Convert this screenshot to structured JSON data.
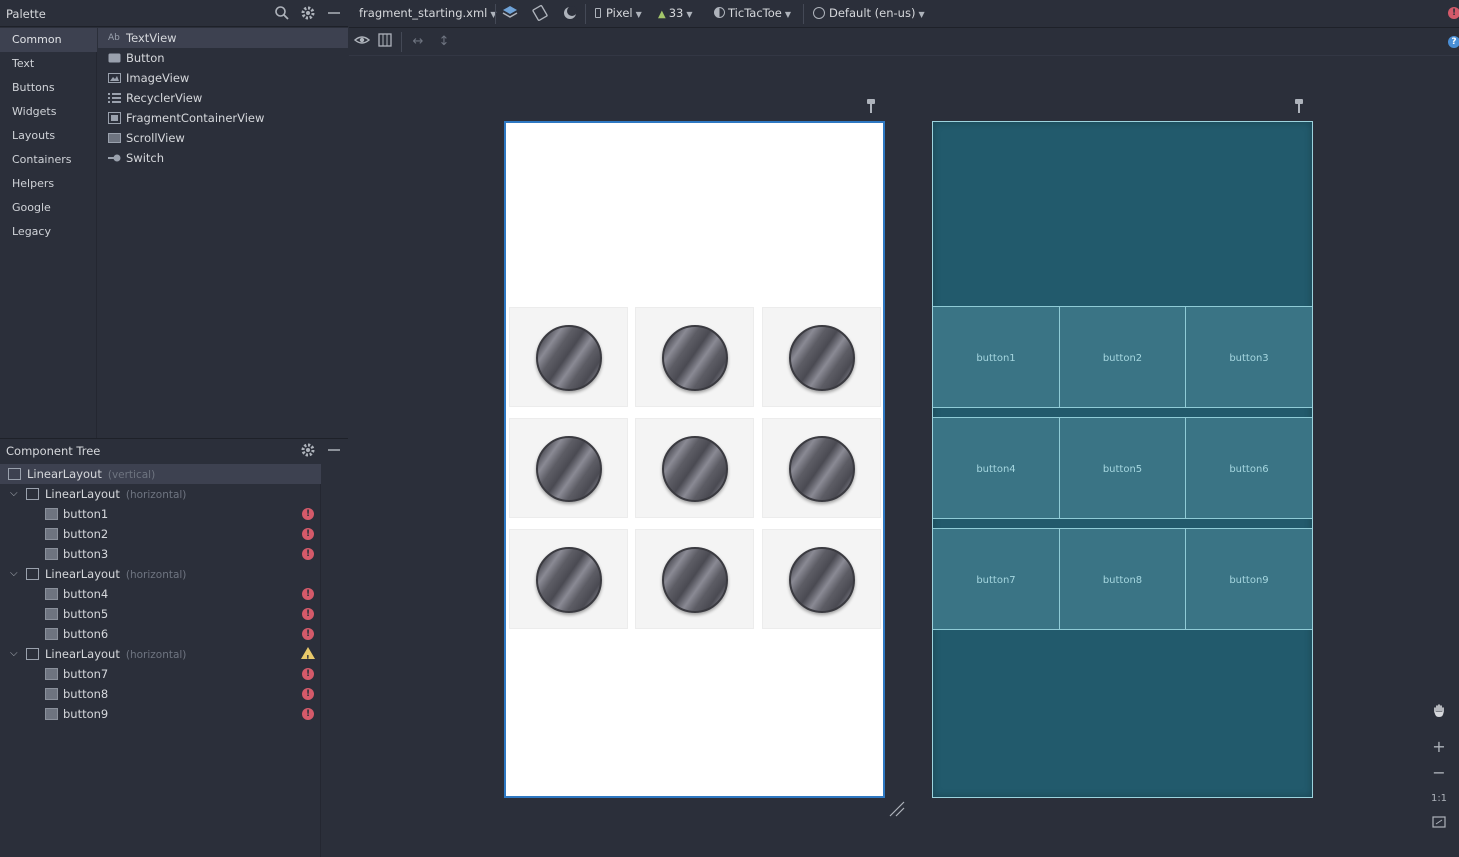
{
  "palette": {
    "title": "Palette",
    "categories": [
      "Common",
      "Text",
      "Buttons",
      "Widgets",
      "Layouts",
      "Containers",
      "Helpers",
      "Google",
      "Legacy"
    ],
    "items": [
      {
        "icon": "Ab",
        "label": "TextView"
      },
      {
        "icon": "",
        "label": "Button"
      },
      {
        "icon": "",
        "label": "ImageView"
      },
      {
        "icon": "",
        "label": "RecyclerView"
      },
      {
        "icon": "",
        "label": "FragmentContainerView"
      },
      {
        "icon": "",
        "label": "ScrollView"
      },
      {
        "icon": "",
        "label": "Switch"
      }
    ]
  },
  "toolbar": {
    "file": "fragment_starting.xml",
    "device": "Pixel",
    "api": "33",
    "theme": "TicTacToe",
    "locale": "Default (en-us)"
  },
  "tree": {
    "title": "Component Tree",
    "rows": [
      {
        "label": "LinearLayout",
        "hint": "(vertical)"
      },
      {
        "label": "LinearLayout",
        "hint": "(horizontal)"
      },
      {
        "label": "button1"
      },
      {
        "label": "button2"
      },
      {
        "label": "button3"
      },
      {
        "label": "LinearLayout",
        "hint": "(horizontal)"
      },
      {
        "label": "button4"
      },
      {
        "label": "button5"
      },
      {
        "label": "button6"
      },
      {
        "label": "LinearLayout",
        "hint": "(horizontal)"
      },
      {
        "label": "button7"
      },
      {
        "label": "button8"
      },
      {
        "label": "button9"
      }
    ]
  },
  "blueprint": {
    "buttons": [
      "button1",
      "button2",
      "button3",
      "button4",
      "button5",
      "button6",
      "button7",
      "button8",
      "button9"
    ]
  },
  "zoom": {
    "one_to_one": "1:1"
  },
  "colors": {
    "background": "#2b2f3a",
    "selection": "#3d4150",
    "error": "#d45a6a",
    "warning": "#e8c96a",
    "blueprint": "#225a6c",
    "design_border": "#2e78c2"
  }
}
